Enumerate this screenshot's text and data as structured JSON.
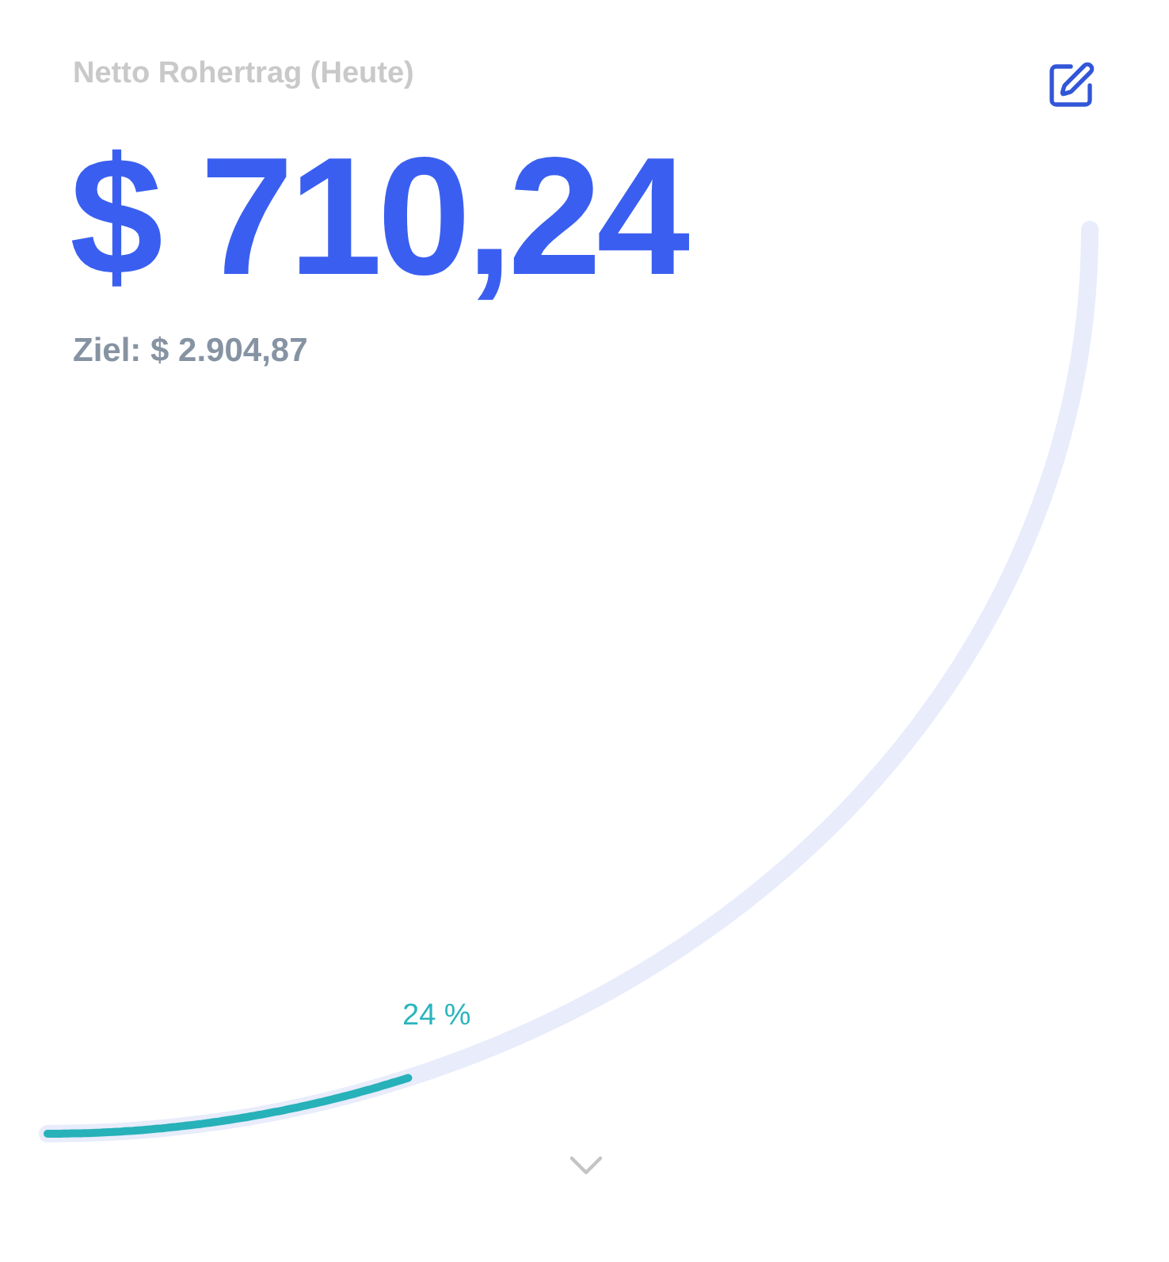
{
  "title": "Netto Rohertrag (Heute)",
  "amount": "$ 710,24",
  "goal": "Ziel: $ 2.904,87",
  "gauge": {
    "reading": "24 %"
  }
}
